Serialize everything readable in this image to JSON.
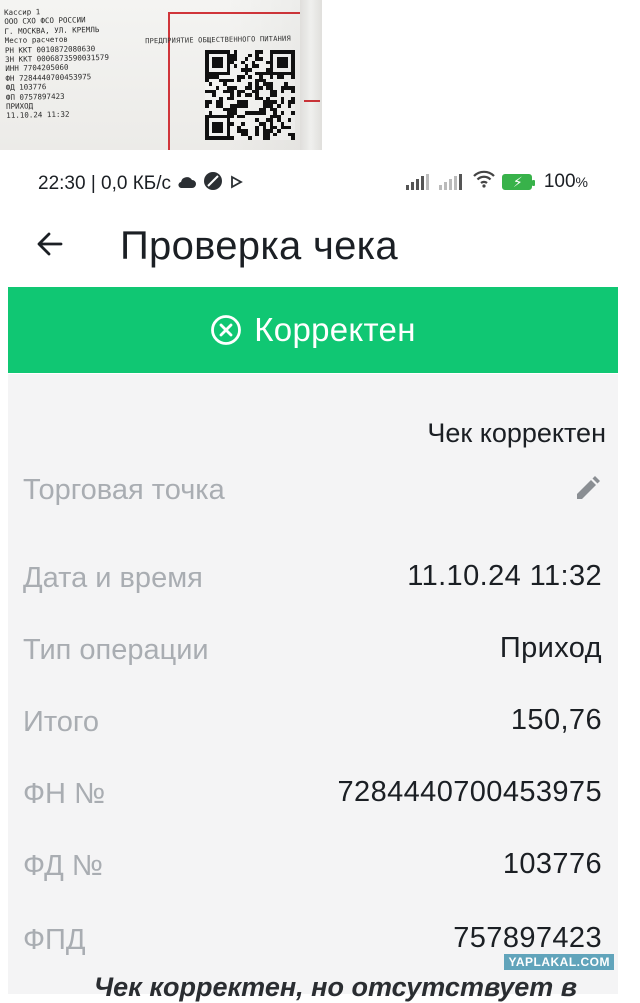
{
  "receipt_photo": {
    "lines": [
      "Кассир 1",
      "ООО СХО ФСО РОССИИ",
      "Г. МОСКВА, УЛ. КРЕМЛЬ",
      "Место расчетов",
      "РН ККТ 0010872080630",
      "ЗН ККТ 0006873590031579",
      "ИНН 7704205060",
      "ФН 7284440700453975",
      "ФД 103776",
      "ФП 0757897423",
      "ПРИХОД",
      "11.10.24 11:32"
    ],
    "company_caption": "ПРЕДПРИЯТИЕ ОБЩЕСТВЕННОГО ПИТАНИЯ"
  },
  "status_bar": {
    "time_and_speed": "22:30 | 0,0 КБ/с",
    "battery_percent": "100",
    "battery_suffix": "%",
    "icons": [
      "cloud-icon",
      "blocked-icon",
      "play-icon",
      "signal-icon",
      "signal-icon",
      "wifi-icon",
      "battery-icon"
    ]
  },
  "header": {
    "back_icon": "arrow-left-icon",
    "title": "Проверка чека"
  },
  "banner": {
    "icon": "circle-x-icon",
    "text": "Корректен",
    "color": "#10c773"
  },
  "details": {
    "verdict": "Чек корректен",
    "rows": [
      {
        "label": "Торговая точка",
        "value": "",
        "icon": "pencil-icon"
      },
      {
        "label": "Дата и время",
        "value": "11.10.24 11:32"
      },
      {
        "label": "Тип операции",
        "value": "Приход"
      },
      {
        "label": "Итого",
        "value": "150,76"
      },
      {
        "label": "ФН №",
        "value": "7284440700453975"
      },
      {
        "label": "ФД №",
        "value": "103776"
      },
      {
        "label": "ФПД",
        "value": "757897423"
      }
    ],
    "footer_note": "Чек корректен, но отсутствует в"
  },
  "watermark": "YAPLAKAL.COM"
}
